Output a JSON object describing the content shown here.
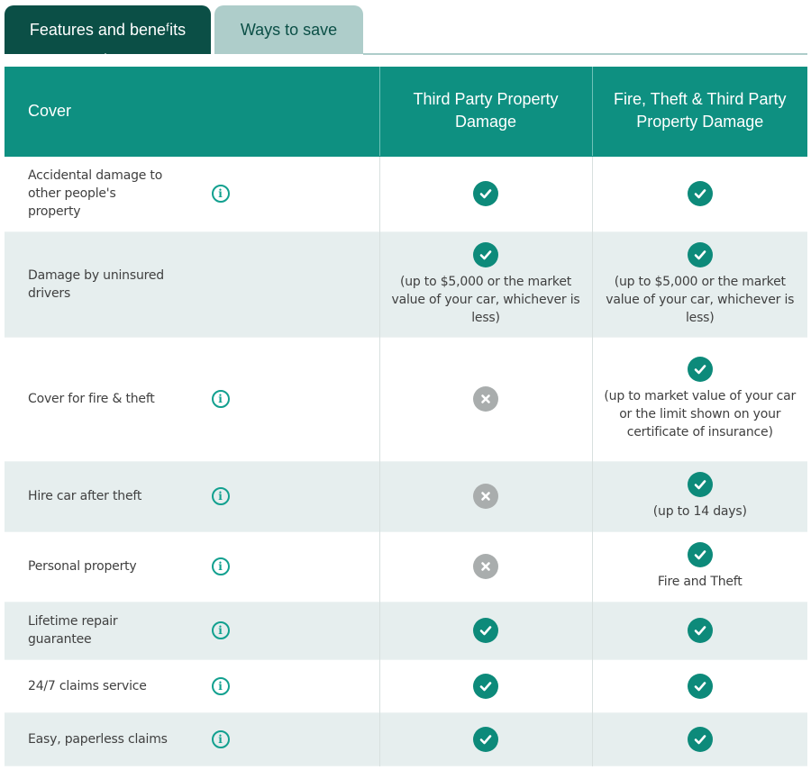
{
  "tabs": [
    {
      "label": "Features and beneᶠits",
      "active": true
    },
    {
      "label": "Ways to save",
      "active": false
    }
  ],
  "colors": {
    "tab_active": "#0b4f46",
    "tab_inactive": "#aecdca",
    "header_bg": "#0e9081",
    "check": "#0d8a7a",
    "cross": "#a9adad",
    "alt_row": "#e6eeee"
  },
  "table": {
    "feature_header": "Cover",
    "plans": [
      "Third Party Property Damage",
      "Fire, Theft & Third Party Property Damage"
    ],
    "rows": [
      {
        "feature": "Accidental damage to other people's property",
        "info": true,
        "cells": [
          {
            "included": true,
            "note": ""
          },
          {
            "included": true,
            "note": ""
          }
        ]
      },
      {
        "feature": "Damage by uninsured drivers",
        "info": false,
        "cells": [
          {
            "included": true,
            "note": "(up to $5,000 or the market value of your car, whichever is less)"
          },
          {
            "included": true,
            "note": "(up to $5,000 or the market value of your car, whichever is less)"
          }
        ]
      },
      {
        "feature": "Cover for fire & theft",
        "info": true,
        "cells": [
          {
            "included": false,
            "note": ""
          },
          {
            "included": true,
            "note": "(up to market value of your car or the limit shown on your certificate of insurance)"
          }
        ]
      },
      {
        "feature": "Hire car after theft",
        "info": true,
        "cells": [
          {
            "included": false,
            "note": ""
          },
          {
            "included": true,
            "note": "(up to 14 days)"
          }
        ]
      },
      {
        "feature": "Personal property",
        "info": true,
        "cells": [
          {
            "included": false,
            "note": ""
          },
          {
            "included": true,
            "note": "Fire and Theft"
          }
        ]
      },
      {
        "feature": "Lifetime repair guarantee",
        "info": true,
        "cells": [
          {
            "included": true,
            "note": ""
          },
          {
            "included": true,
            "note": ""
          }
        ]
      },
      {
        "feature": "24/7 claims service",
        "info": true,
        "cells": [
          {
            "included": true,
            "note": ""
          },
          {
            "included": true,
            "note": ""
          }
        ]
      },
      {
        "feature": "Easy, paperless claims",
        "info": true,
        "cells": [
          {
            "included": true,
            "note": ""
          },
          {
            "included": true,
            "note": ""
          }
        ]
      }
    ]
  },
  "icons": {
    "info": "info-circle-icon",
    "included": "check-circle-icon",
    "excluded": "cross-circle-icon"
  }
}
